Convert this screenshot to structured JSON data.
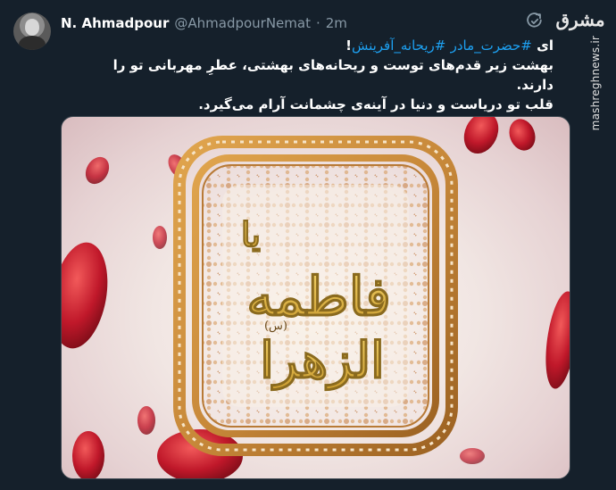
{
  "tweet": {
    "display_name": "N. Ahmadpour",
    "handle": "@AhmadpourNemat",
    "separator": "·",
    "time": "2m",
    "text_prefix": "ای",
    "hashtag_1": "#حضرت_مادر",
    "hashtag_2": "#ریحانه_آفرینش",
    "text_suffix": "!",
    "line_2": "بهشت زیر قدم‌های توست و ریحانه‌های بهشتی، عطرِ مهربانی تو را دارند.",
    "line_3": "قلب تو دریاست و دنیا در آینه‌ی چشمانت آرام می‌گیرد."
  },
  "image": {
    "calligraphy_top": "یا",
    "calligraphy_main": "فاطمه",
    "calligraphy_bottom": "الزهرا",
    "calligraphy_honorific": "(س)"
  },
  "watermark": {
    "logo": "مشرق",
    "site": "mashreghnews.ir"
  },
  "icons": {
    "retweet": "retweet-icon"
  },
  "colors": {
    "background": "#15202b",
    "hashtag": "#1da1f2",
    "muted": "#8899a6",
    "frame_gold": "#c8893a",
    "petal_red": "#c0182a"
  }
}
